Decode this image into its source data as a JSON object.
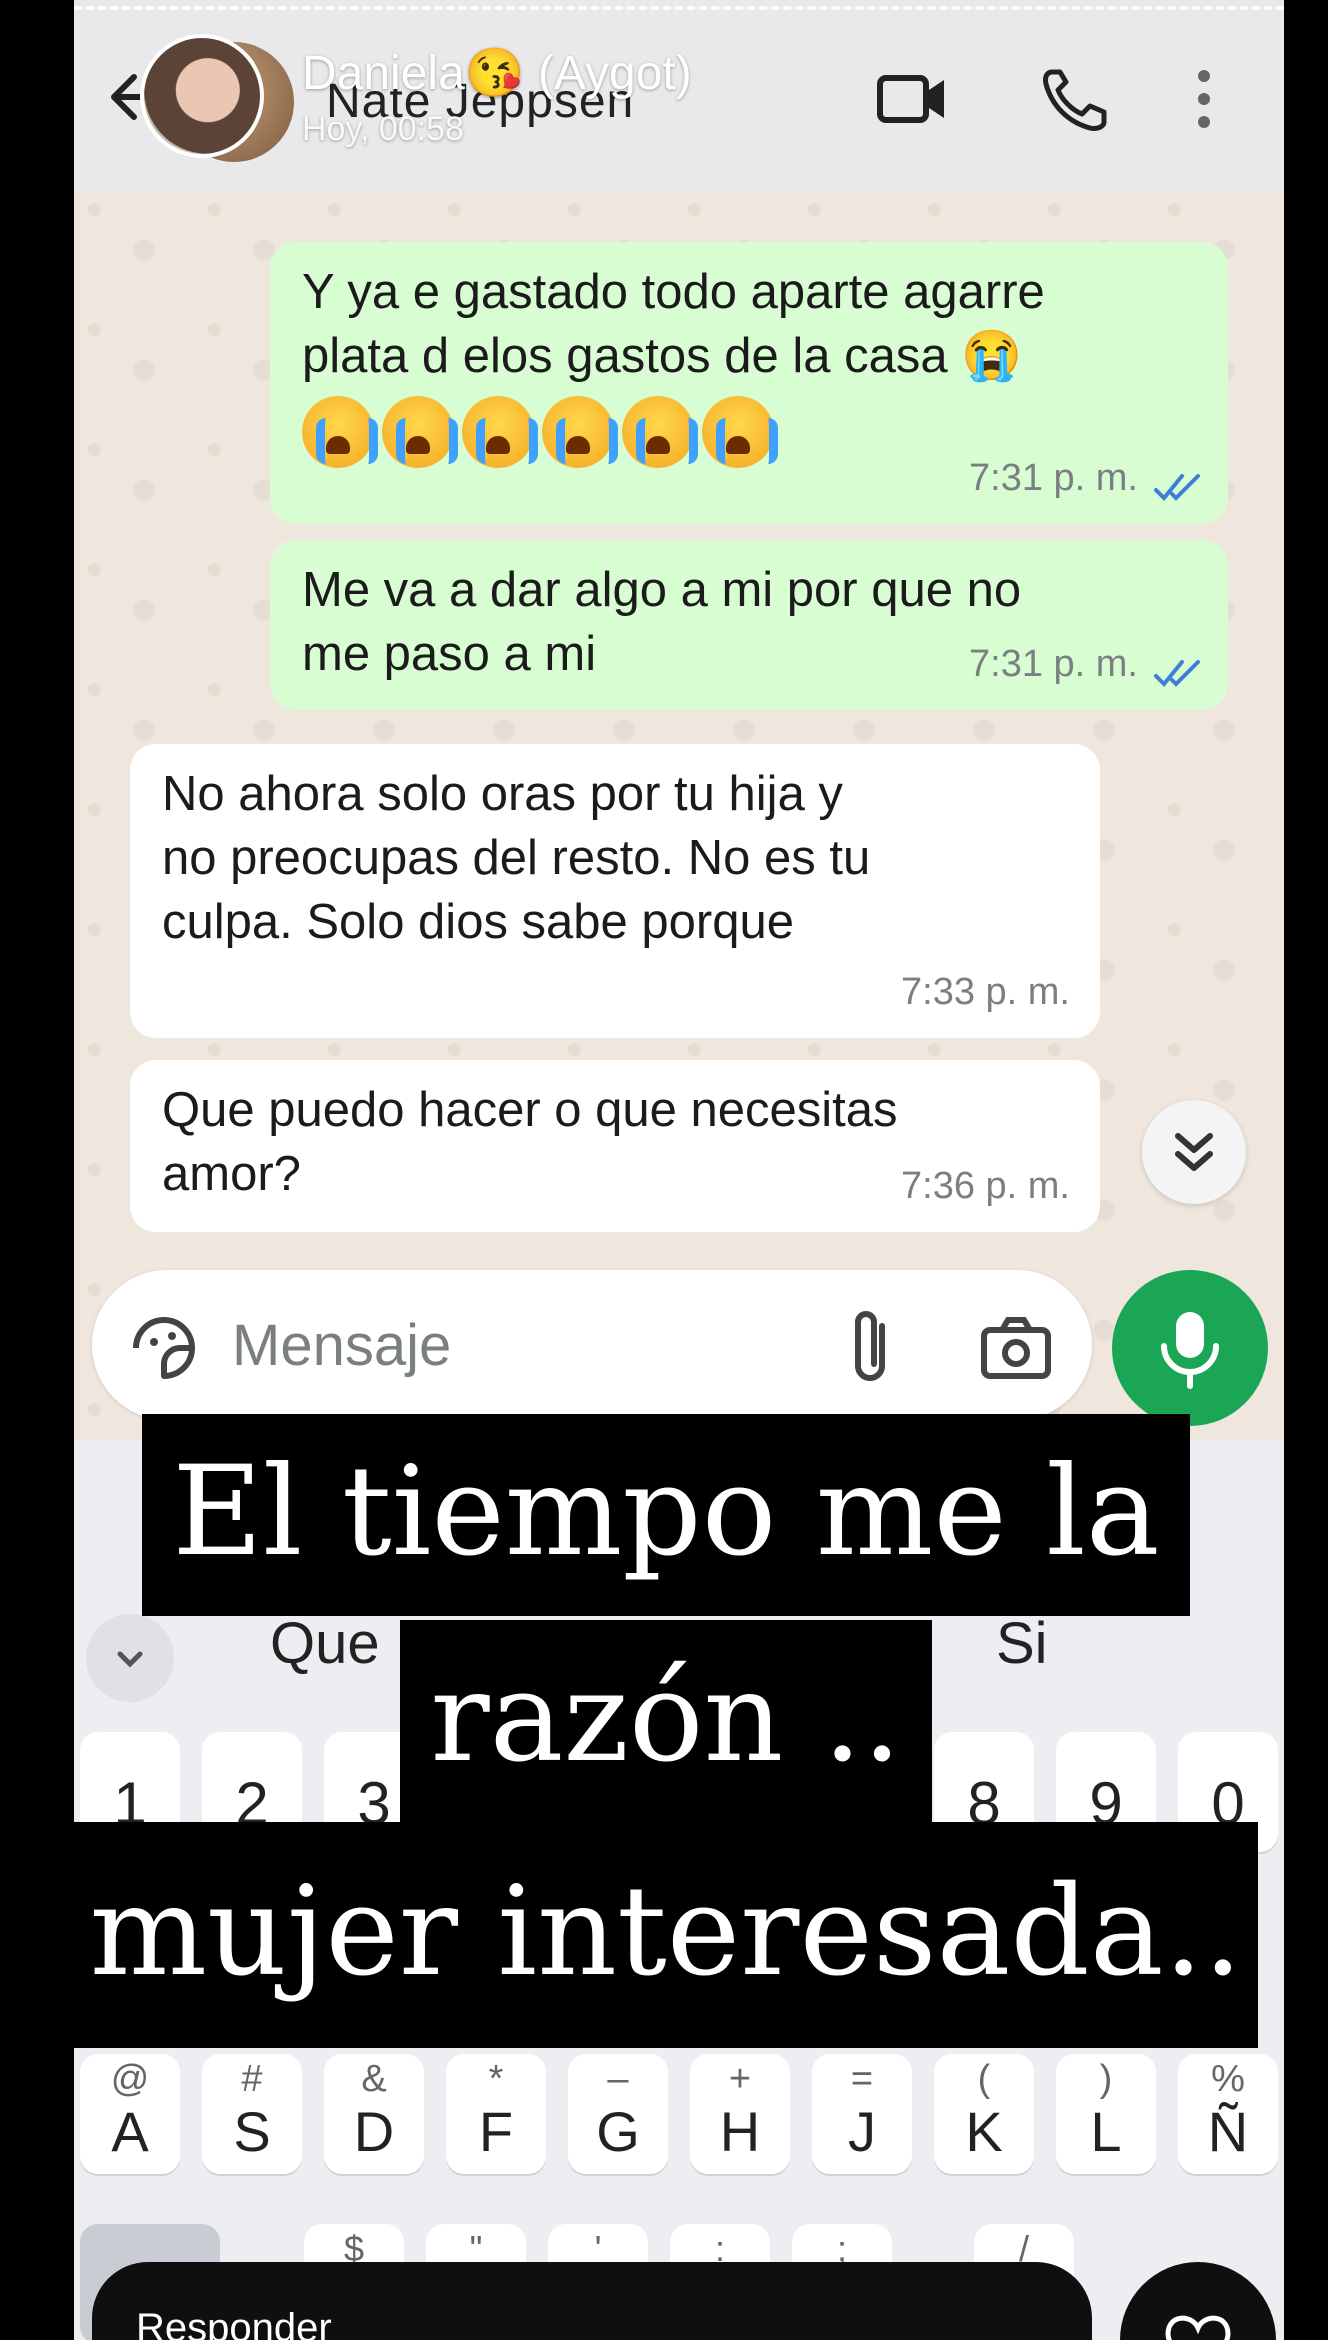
{
  "header": {
    "contact_name": "Nate Jeppsen",
    "story_user": "Daniela😘 (Aygot)",
    "story_time": "Hoy, 00:58"
  },
  "messages": [
    {
      "direction": "outgoing",
      "text_line1": "Y ya e gastado todo aparte agarre",
      "text_line2": "plata d elos gastos de la casa 😭",
      "emojis": [
        "😭",
        "😭",
        "😭",
        "😭",
        "😭",
        "😭"
      ],
      "time": "7:31 p. m.",
      "status": "read"
    },
    {
      "direction": "outgoing",
      "text_line1": "Me va a dar algo a mi por que no",
      "text_line2": "me paso a mi",
      "time": "7:31 p. m.",
      "status": "read"
    },
    {
      "direction": "incoming",
      "text_line1": "No ahora solo oras por tu hija y",
      "text_line2": "no preocupas del resto.  No es tu",
      "text_line3": "culpa.  Solo dios sabe porque",
      "time": "7:33 p. m."
    },
    {
      "direction": "incoming",
      "text_line1": "Que puedo hacer o que necesitas",
      "text_line2": "amor?",
      "time": "7:36 p. m."
    }
  ],
  "composer": {
    "placeholder": "Mensaje"
  },
  "keyboard": {
    "suggestions": [
      "Que",
      "Si"
    ],
    "number_row": [
      "1",
      "2",
      "3",
      "8",
      "9",
      "0"
    ],
    "middle_row": [
      {
        "main": "A",
        "sub": "@"
      },
      {
        "main": "S",
        "sub": "#"
      },
      {
        "main": "D",
        "sub": "&"
      },
      {
        "main": "F",
        "sub": "*"
      },
      {
        "main": "G",
        "sub": "–"
      },
      {
        "main": "H",
        "sub": "+"
      },
      {
        "main": "J",
        "sub": "="
      },
      {
        "main": "K",
        "sub": "("
      },
      {
        "main": "L",
        "sub": ")"
      },
      {
        "main": "Ñ",
        "sub": "%"
      }
    ],
    "bottom_row_subs": [
      "$",
      "\"",
      "'",
      ":",
      ";",
      "/"
    ]
  },
  "captions": {
    "line1": "El tiempo me la",
    "line2": "razón ..",
    "line3": "mujer interesada.."
  },
  "story_reply": {
    "label": "Responder"
  },
  "colors": {
    "outgoing_bubble": "#d9fdd3",
    "incoming_bubble": "#ffffff",
    "mic_green": "#1aa654",
    "read_ticks": "#3e7fd6"
  }
}
